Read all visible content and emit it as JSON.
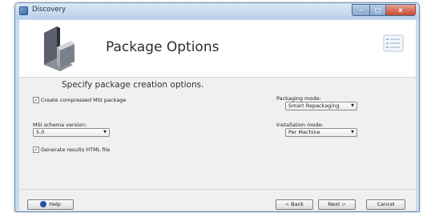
{
  "window": {
    "title": "Discovery"
  },
  "header": {
    "title": "Package Options"
  },
  "main": {
    "subtitle": "Specify package creation options.",
    "create_compressed_msi": {
      "label": "Create compressed MSI package",
      "checked": true
    },
    "msi_schema_version": {
      "label": "MSI schema version:",
      "value": "5.0"
    },
    "packaging_mode": {
      "label": "Packaging mode:",
      "value": "Smart Repackaging"
    },
    "installation_mode": {
      "label": "Installation mode:",
      "value": "Per Machine"
    },
    "generate_html": {
      "label": "Generate results HTML file",
      "checked": true
    }
  },
  "footer": {
    "help": "Help",
    "back": "Back",
    "next": "Next",
    "cancel": "Cancel"
  },
  "glyphs": {
    "checkmark": "✓",
    "dropdown": "▼",
    "back_arrow": "<",
    "next_arrow": ">",
    "minimize": "–",
    "maximize": "□",
    "close": "x"
  }
}
